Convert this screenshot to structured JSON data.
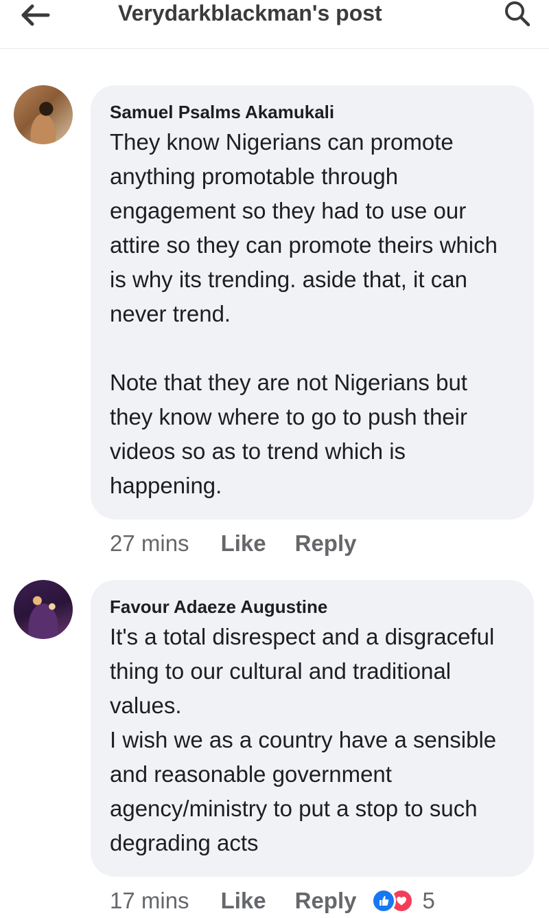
{
  "header": {
    "title": "Verydarkblackman's post",
    "back_icon": "arrow-left-icon",
    "search_icon": "search-icon"
  },
  "comments": [
    {
      "author": "Samuel Psalms Akamukali",
      "paragraphs": [
        "They know Nigerians can promote anything promotable through engagement so they had to use our attire so they can promote theirs which is why its trending. aside that, it can never trend.",
        "Note that they are not Nigerians but they know where to go to push their videos so as to trend which is happening."
      ],
      "time": "27 mins",
      "like_label": "Like",
      "reply_label": "Reply"
    },
    {
      "author": "Favour Adaeze Augustine",
      "paragraphs": [
        "It's a total disrespect and a disgraceful thing to our cultural and traditional values.",
        "I wish we as a country have a sensible and reasonable government agency/ministry to put a stop to such degrading acts"
      ],
      "time": "17 mins",
      "like_label": "Like",
      "reply_label": "Reply",
      "reactions": {
        "icons": [
          "like-reaction-icon",
          "love-reaction-icon"
        ],
        "count": "5"
      }
    }
  ],
  "colors": {
    "bubble": "#f0f2f5",
    "meta_text": "#65676b",
    "like_blue": "#1877f2",
    "love_red": "#f33e58"
  }
}
